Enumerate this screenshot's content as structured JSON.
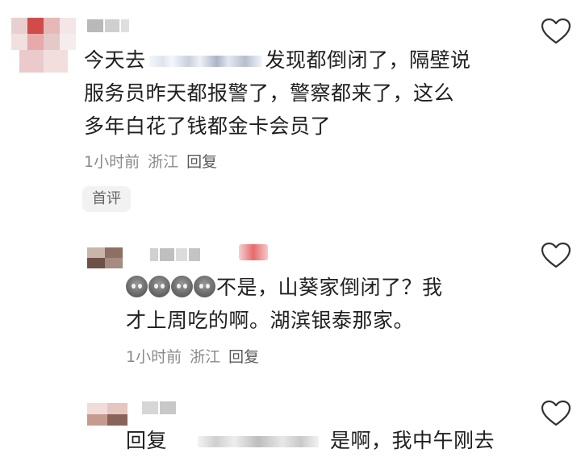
{
  "comments": [
    {
      "text_line1_pre": "今天去",
      "text_line1_post": "发现都倒闭了，隔壁说",
      "text_line2": "服务员昨天都报警了，警察都来了，这么",
      "text_line3": "多年白花了钱都金卡会员了",
      "time": "1小时前",
      "location": "浙江",
      "reply": "回复",
      "badge": "首评"
    },
    {
      "text_line1": "不是，山葵家倒闭了？我",
      "text_line2": "才上周吃的啊。湖滨银泰那家。",
      "time": "1小时前",
      "location": "浙江",
      "reply": "回复"
    },
    {
      "text_pre": "回复",
      "text_post": "是啊，我中午刚去"
    }
  ],
  "icons": {
    "like": "heart-outline-icon",
    "emoji": "cool-pig-emoji-icon"
  }
}
